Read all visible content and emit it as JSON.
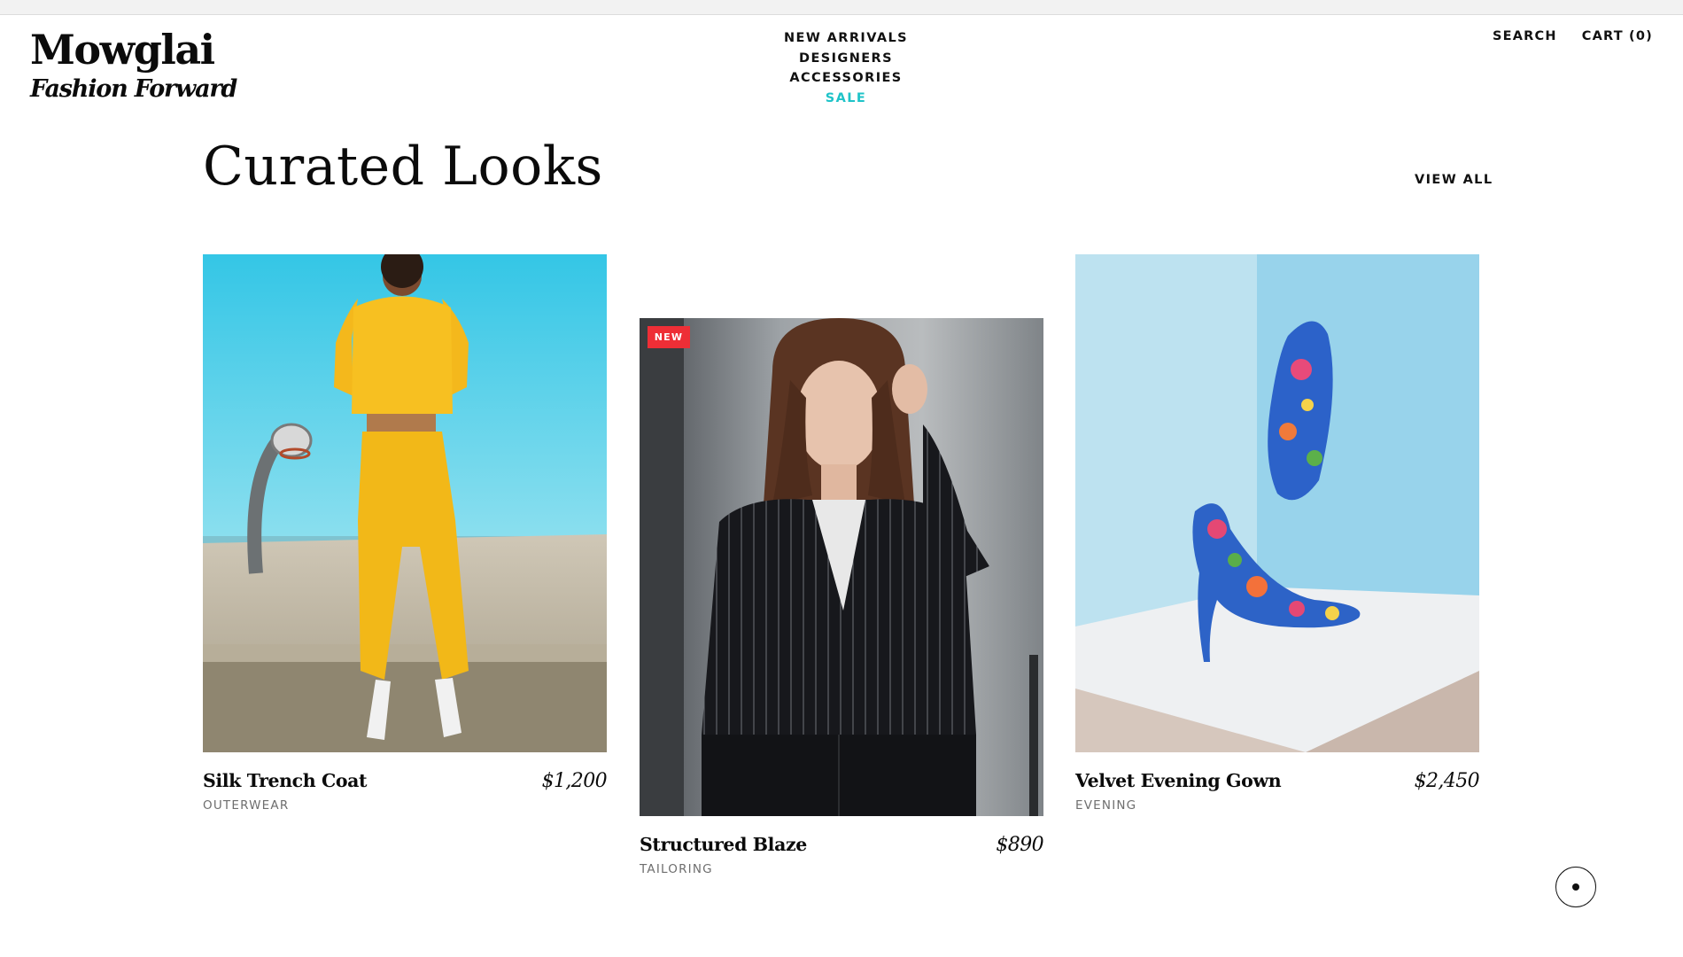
{
  "brand": {
    "name": "Mowglai",
    "tagline": "Fashion Forward"
  },
  "nav": {
    "items": [
      {
        "label": "NEW ARRIVALS"
      },
      {
        "label": "DESIGNERS"
      },
      {
        "label": "ACCESSORIES"
      },
      {
        "label": "SALE"
      }
    ],
    "sale_color": "#1ec3c8"
  },
  "utility": {
    "search_label": "SEARCH",
    "cart_label": "CART (0)"
  },
  "section": {
    "title": "Curated Looks",
    "view_all_label": "VIEW ALL"
  },
  "products": [
    {
      "name": "Silk Trench Coat",
      "category": "OUTERWEAR",
      "price": "$1,200",
      "image": "yellow-tracksuit-photo"
    },
    {
      "name": "Structured Blaze",
      "category": "TAILORING",
      "price": "$890",
      "badge": "NEW",
      "image": "pinstripe-blazer-photo"
    },
    {
      "name": "Velvet Evening Gown",
      "category": "EVENING",
      "price": "$2,450",
      "image": "floral-stiletto-photo"
    }
  ],
  "colors": {
    "badge": "#ee2e36",
    "accent": "#1ec3c8"
  },
  "icons": {
    "scroll": "dot-icon"
  }
}
